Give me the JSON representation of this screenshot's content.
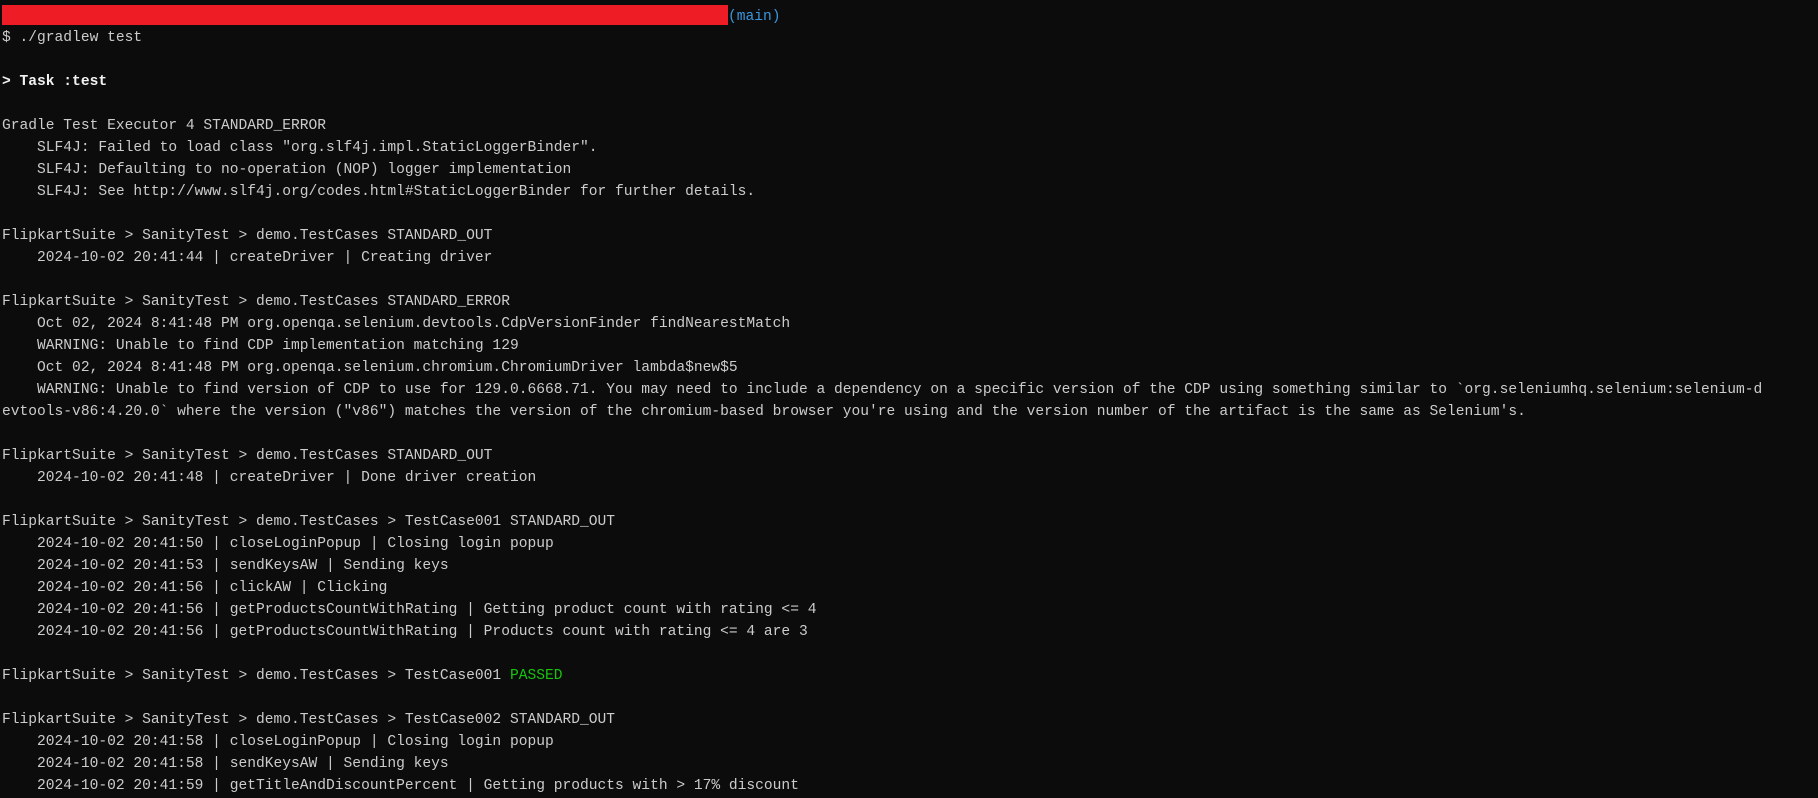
{
  "colors": {
    "redaction": "#ee1c25",
    "branch": "#3a96dd",
    "passed": "#16c60c",
    "text": "#cccccc",
    "background": "#0c0c0c"
  },
  "prompt": {
    "branch": "(main)",
    "command": "$ ./gradlew test"
  },
  "lines": [
    {
      "type": "prompt-header"
    },
    {
      "type": "command"
    },
    {
      "text": ""
    },
    {
      "text": "> Task :test",
      "style": "bold"
    },
    {
      "text": ""
    },
    {
      "text": "Gradle Test Executor 4 STANDARD_ERROR"
    },
    {
      "text": "    SLF4J: Failed to load class \"org.slf4j.impl.StaticLoggerBinder\"."
    },
    {
      "text": "    SLF4J: Defaulting to no-operation (NOP) logger implementation"
    },
    {
      "text": "    SLF4J: See http://www.slf4j.org/codes.html#StaticLoggerBinder for further details."
    },
    {
      "text": ""
    },
    {
      "text": "FlipkartSuite > SanityTest > demo.TestCases STANDARD_OUT"
    },
    {
      "text": "    2024-10-02 20:41:44 | createDriver | Creating driver"
    },
    {
      "text": ""
    },
    {
      "text": "FlipkartSuite > SanityTest > demo.TestCases STANDARD_ERROR"
    },
    {
      "text": "    Oct 02, 2024 8:41:48 PM org.openqa.selenium.devtools.CdpVersionFinder findNearestMatch"
    },
    {
      "text": "    WARNING: Unable to find CDP implementation matching 129"
    },
    {
      "text": "    Oct 02, 2024 8:41:48 PM org.openqa.selenium.chromium.ChromiumDriver lambda$new$5"
    },
    {
      "text": "    WARNING: Unable to find version of CDP to use for 129.0.6668.71. You may need to include a dependency on a specific version of the CDP using something similar to `org.seleniumhq.selenium:selenium-d"
    },
    {
      "text": "evtools-v86:4.20.0` where the version (\"v86\") matches the version of the chromium-based browser you're using and the version number of the artifact is the same as Selenium's."
    },
    {
      "text": ""
    },
    {
      "text": "FlipkartSuite > SanityTest > demo.TestCases STANDARD_OUT"
    },
    {
      "text": "    2024-10-02 20:41:48 | createDriver | Done driver creation"
    },
    {
      "text": ""
    },
    {
      "text": "FlipkartSuite > SanityTest > demo.TestCases > TestCase001 STANDARD_OUT"
    },
    {
      "text": "    2024-10-02 20:41:50 | closeLoginPopup | Closing login popup"
    },
    {
      "text": "    2024-10-02 20:41:53 | sendKeysAW | Sending keys"
    },
    {
      "text": "    2024-10-02 20:41:56 | clickAW | Clicking"
    },
    {
      "text": "    2024-10-02 20:41:56 | getProductsCountWithRating | Getting product count with rating <= 4"
    },
    {
      "text": "    2024-10-02 20:41:56 | getProductsCountWithRating | Products count with rating <= 4 are 3"
    },
    {
      "text": ""
    },
    {
      "text": "FlipkartSuite > SanityTest > demo.TestCases > TestCase001 ",
      "status": "PASSED"
    },
    {
      "text": ""
    },
    {
      "text": "FlipkartSuite > SanityTest > demo.TestCases > TestCase002 STANDARD_OUT"
    },
    {
      "text": "    2024-10-02 20:41:58 | closeLoginPopup | Closing login popup"
    },
    {
      "text": "    2024-10-02 20:41:58 | sendKeysAW | Sending keys"
    },
    {
      "text": "    2024-10-02 20:41:59 | getTitleAndDiscountPercent | Getting products with > 17% discount"
    }
  ]
}
